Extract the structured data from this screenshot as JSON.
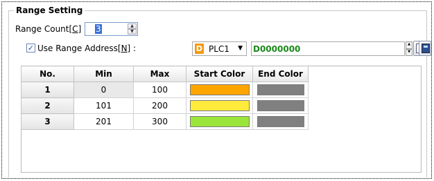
{
  "group": {
    "title": "Range Setting"
  },
  "range_count": {
    "label": "Range Count[",
    "hotkey": "C",
    "label_end": "] :",
    "value": "3"
  },
  "use_range_address": {
    "checked": true,
    "check_glyph": "✓",
    "label": "Use Range Address[",
    "hotkey": "N",
    "label_end": "] :"
  },
  "device": {
    "icon_letter": "D",
    "selected": "PLC1",
    "dropdown_glyph": "▼"
  },
  "address": {
    "value": "D0000000"
  },
  "table": {
    "headers": [
      "No.",
      "Min",
      "Max",
      "Start Color",
      "End Color"
    ],
    "rows": [
      {
        "no": "1",
        "min": "0",
        "max": "100",
        "start_color": "#ffa500",
        "end_color": "#808080"
      },
      {
        "no": "2",
        "min": "101",
        "max": "200",
        "start_color": "#ffeb3b",
        "end_color": "#808080"
      },
      {
        "no": "3",
        "min": "201",
        "max": "300",
        "start_color": "#9be53b",
        "end_color": "#808080"
      }
    ]
  },
  "glyphs": {
    "up": "▲",
    "down": "▼"
  }
}
